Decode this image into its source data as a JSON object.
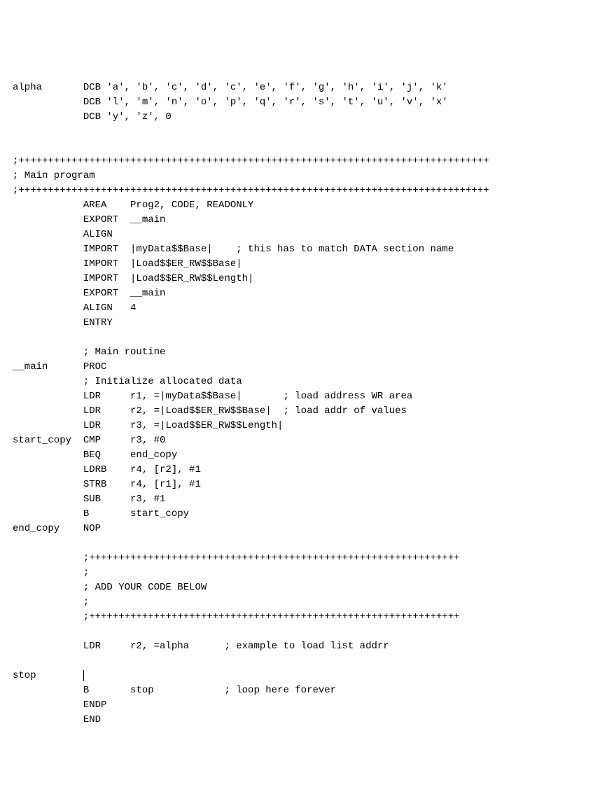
{
  "lines": {
    "l0": "alpha       DCB 'a', 'b', 'c', 'd', 'c', 'e', 'f', 'g', 'h', 'i', 'j', 'k'",
    "l1": "            DCB 'l', 'm', 'n', 'o', 'p', 'q', 'r', 's', 't', 'u', 'v', 'x'",
    "l2": "            DCB 'y', 'z', 0",
    "l3": "",
    "l4": "",
    "l5": ";++++++++++++++++++++++++++++++++++++++++++++++++++++++++++++++++++++++++++++++++",
    "l6": "; Main program",
    "l7": ";++++++++++++++++++++++++++++++++++++++++++++++++++++++++++++++++++++++++++++++++",
    "l8": "            AREA    Prog2, CODE, READONLY",
    "l9": "            EXPORT  __main",
    "l10": "            ALIGN",
    "l11": "            IMPORT  |myData$$Base|    ; this has to match DATA section name",
    "l12": "            IMPORT  |Load$$ER_RW$$Base|",
    "l13": "            IMPORT  |Load$$ER_RW$$Length|",
    "l14": "            EXPORT  __main",
    "l15": "            ALIGN   4",
    "l16": "            ENTRY",
    "l17": "",
    "l18": "            ; Main routine",
    "l19": "__main      PROC",
    "l20": "            ; Initialize allocated data",
    "l21": "            LDR     r1, =|myData$$Base|       ; load address WR area",
    "l22": "            LDR     r2, =|Load$$ER_RW$$Base|  ; load addr of values",
    "l23": "            LDR     r3, =|Load$$ER_RW$$Length|",
    "l24": "start_copy  CMP     r3, #0",
    "l25": "            BEQ     end_copy",
    "l26": "            LDRB    r4, [r2], #1",
    "l27": "            STRB    r4, [r1], #1",
    "l28": "            SUB     r3, #1",
    "l29": "            B       start_copy",
    "l30": "end_copy    NOP",
    "l31": "",
    "l32": "            ;+++++++++++++++++++++++++++++++++++++++++++++++++++++++++++++++",
    "l33": "            ;",
    "l34": "            ; ADD YOUR CODE BELOW",
    "l35": "            ;",
    "l36": "            ;+++++++++++++++++++++++++++++++++++++++++++++++++++++++++++++++",
    "l37": "",
    "l38": "            LDR     r2, =alpha      ; example to load list addrr",
    "l39": "",
    "l40a": "stop        ",
    "l41": "            B       stop            ; loop here forever",
    "l42": "            ENDP",
    "l43": "            END"
  }
}
